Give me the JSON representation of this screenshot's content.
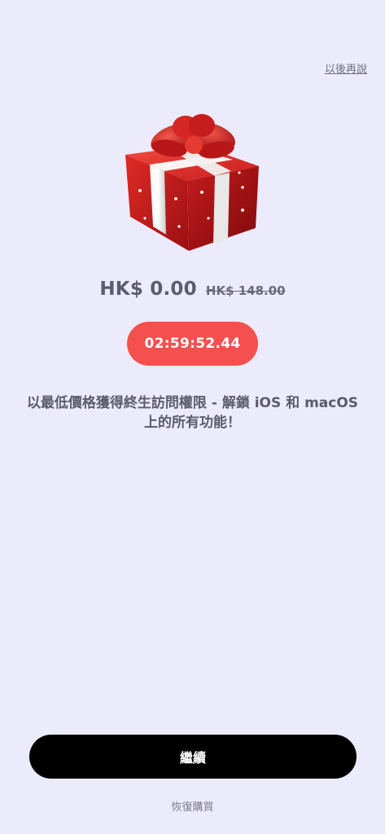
{
  "header": {
    "later_label": "以後再說"
  },
  "hero": {
    "icon": "gift-box-icon"
  },
  "pricing": {
    "current_price": "HK$ 0.00",
    "original_price": "HK$ 148.00"
  },
  "countdown": {
    "time": "02:59:52.44"
  },
  "description": {
    "line1": "以最低價格獲得終生訪問權限 - 解鎖 iOS 和 macOS",
    "line2": "上的所有功能！"
  },
  "actions": {
    "continue_label": "繼續",
    "restore_label": "恢復購買"
  },
  "colors": {
    "background": "#ecebfc",
    "timer_red": "#f3504f",
    "button_black": "#000000"
  }
}
